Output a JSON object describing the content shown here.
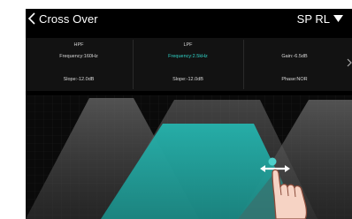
{
  "header": {
    "title": "Cross Over",
    "channel": "SP RL"
  },
  "params": {
    "hpf": {
      "label": "HPF",
      "frequency": "Frequency:160Hz",
      "slope": "Slope:-12.0dB"
    },
    "lpf": {
      "label": "LPF",
      "frequency": "Frequency:2.5kHz",
      "slope": "Slope:-12.0dB"
    },
    "gain": {
      "gain": "Gain:-6.5dB",
      "phase": "Phase:NOR"
    }
  },
  "colors": {
    "background": "#000000",
    "panel": "#121212",
    "accent": "#2fd2c6",
    "active_band": "#1f9d99",
    "inactive_band": "#5a5a5a"
  },
  "icons": {
    "back": "chevron-left-icon",
    "dropdown": "triangle-down-icon",
    "more": "more-arrow-icon",
    "drag": "horizontal-drag-arrows-icon",
    "hand": "pointing-hand-icon"
  }
}
